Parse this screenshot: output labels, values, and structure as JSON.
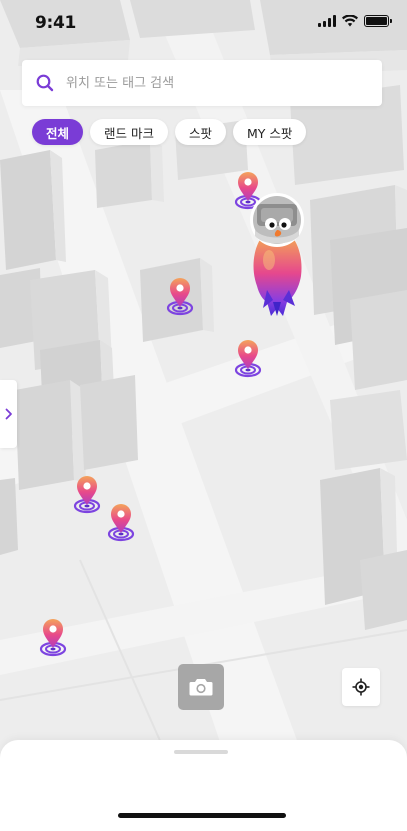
{
  "status_bar": {
    "time": "9:41"
  },
  "search": {
    "placeholder": "위치 또는 태그 검색",
    "value": ""
  },
  "filters": [
    {
      "label": "전체",
      "selected": true
    },
    {
      "label": "랜드 마크",
      "selected": false
    },
    {
      "label": "스팟",
      "selected": false
    },
    {
      "label": "MY 스팟",
      "selected": false
    }
  ],
  "colors": {
    "accent": "#7a3cd6",
    "marker_top": "#f4a35b",
    "marker_mid": "#e84a8a",
    "marker_bottom": "#6f3cd6",
    "building": "#e2e2e2",
    "map_bg": "#eeeeee"
  },
  "icons": {
    "search": "search-icon",
    "side_tab": "chevron-right-icon",
    "camera": "camera-icon",
    "locate": "locate-icon",
    "marker": "map-pin-icon",
    "avatar": "character-avatar"
  }
}
